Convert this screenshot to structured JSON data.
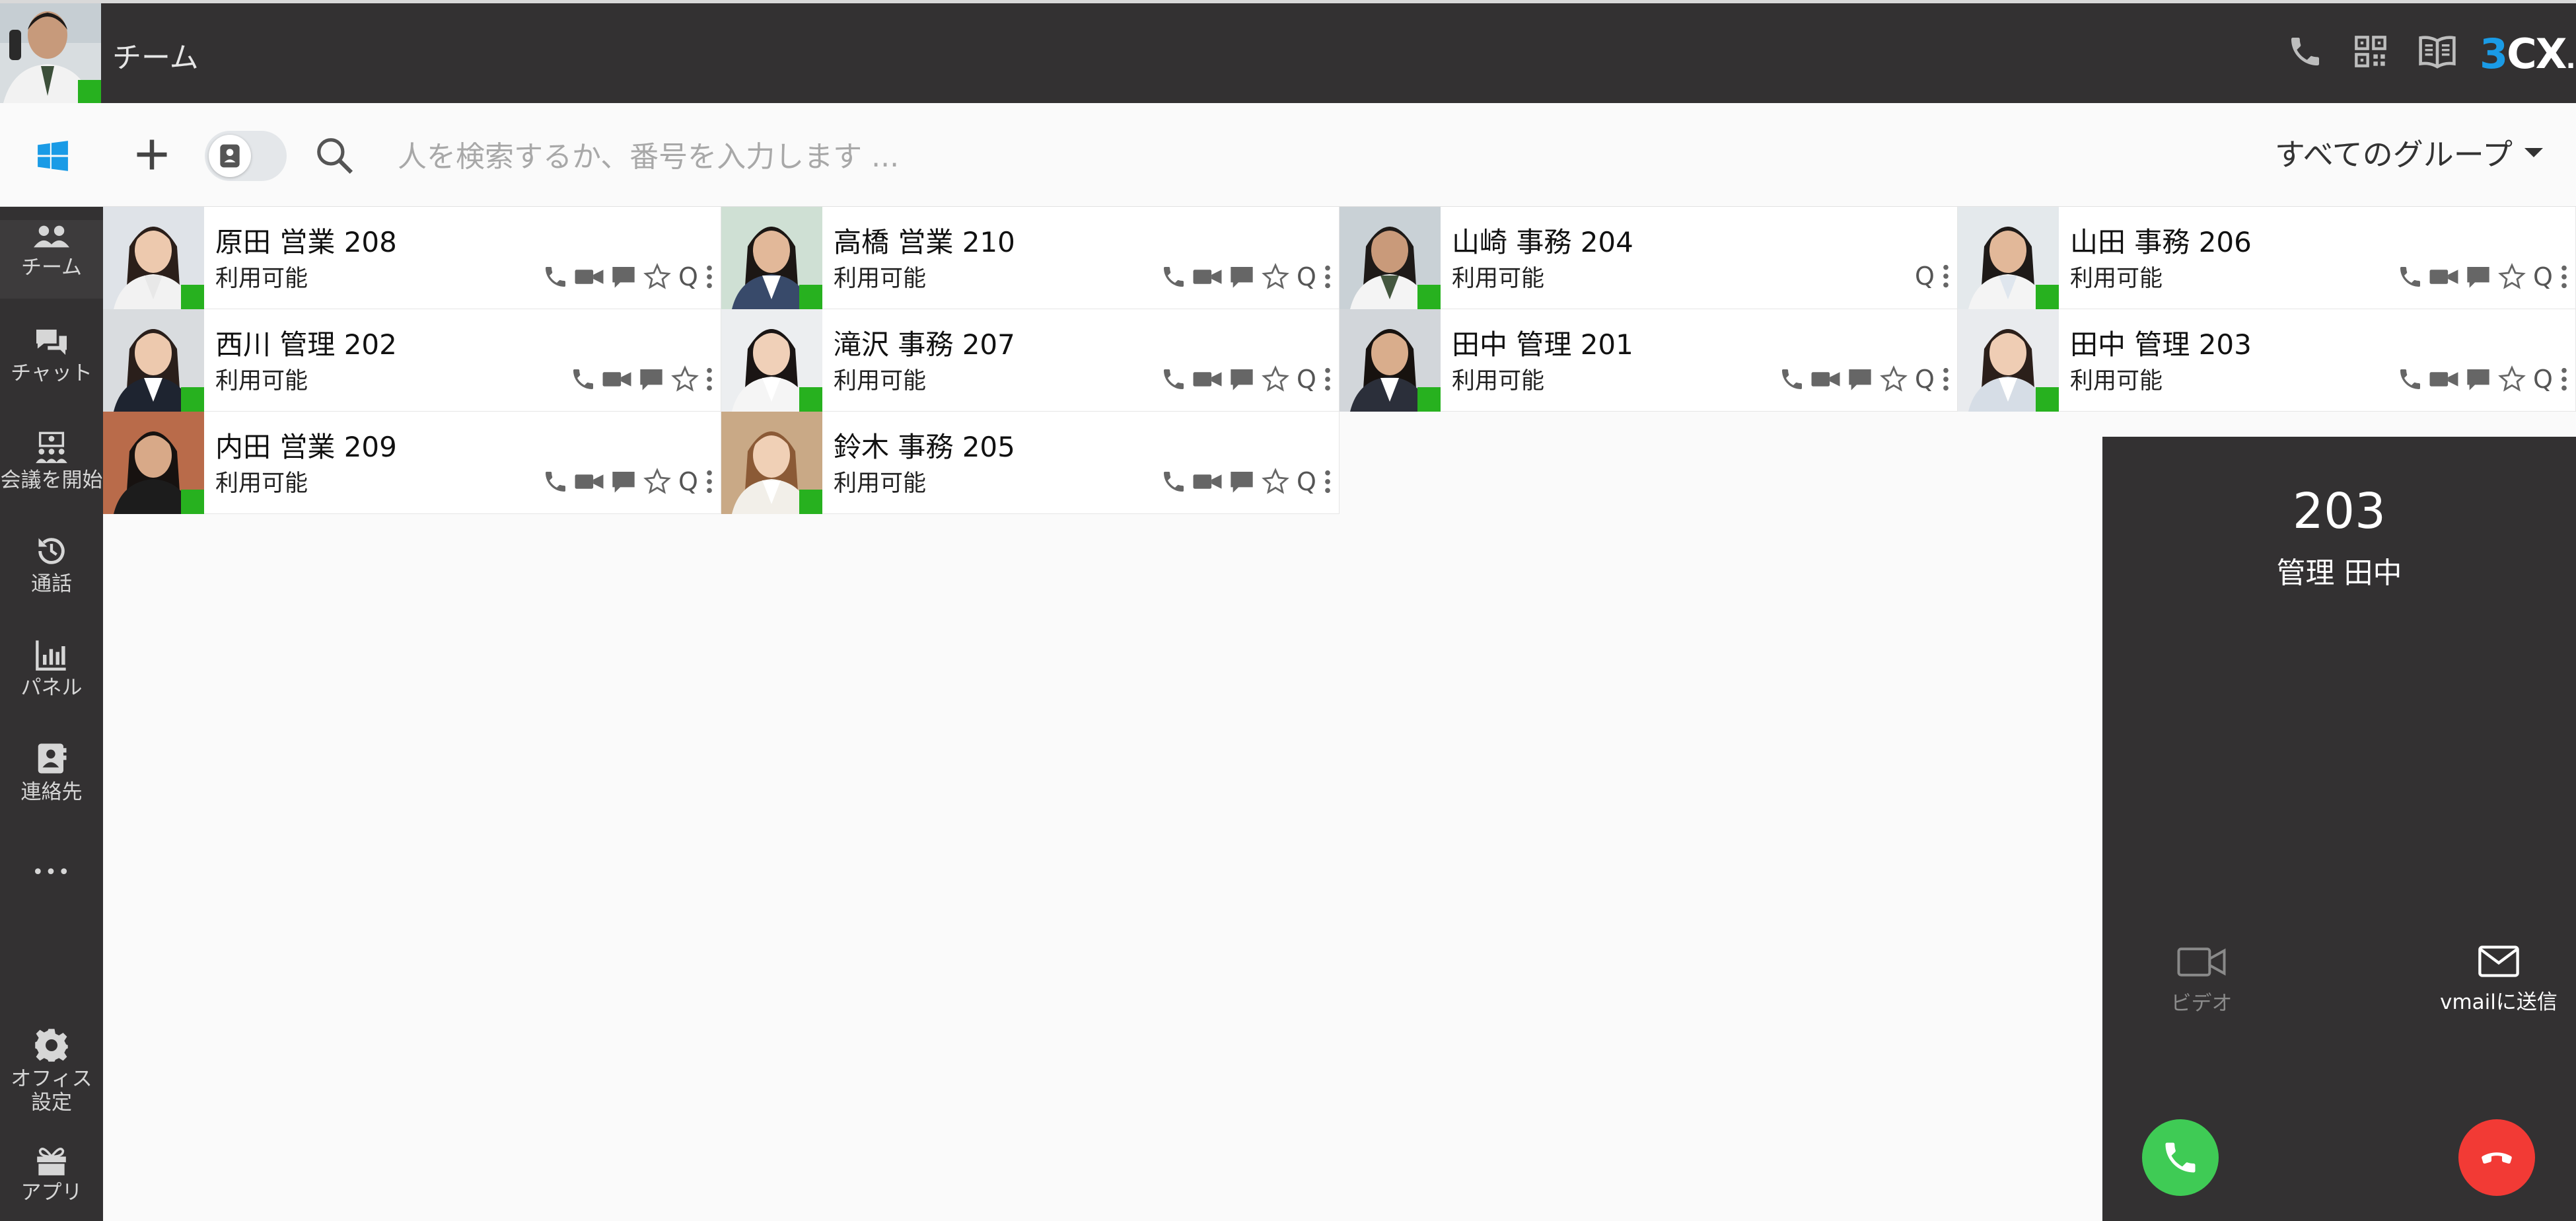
{
  "header": {
    "title": "チーム",
    "logo": {
      "three": "3",
      "cx": "CX",
      "dot": "."
    }
  },
  "toolbar": {
    "search_placeholder": "人を検索するか、番号を入力します ...",
    "group_filter": "すべてのグループ"
  },
  "sidebar": {
    "items": [
      {
        "label": "チーム",
        "icon": "team-icon"
      },
      {
        "label": "チャット",
        "icon": "chat-icon"
      },
      {
        "label": "会議を開始",
        "icon": "meeting-icon"
      },
      {
        "label": "通話",
        "icon": "history-icon"
      },
      {
        "label": "パネル",
        "icon": "panel-icon"
      },
      {
        "label": "連絡先",
        "icon": "contacts-icon"
      },
      {
        "label": "•••",
        "icon": "more-icon"
      }
    ],
    "office_settings": "オフィス設定",
    "apps": "アプリ"
  },
  "contacts": [
    {
      "name": "原田 営業 208",
      "status": "利用可能"
    },
    {
      "name": "高橋 営業 210",
      "status": "利用可能"
    },
    {
      "name": "山崎 事務 204",
      "status": "利用可能"
    },
    {
      "name": "山田 事務 206",
      "status": "利用可能"
    },
    {
      "name": "西川 管理 202",
      "status": "利用可能"
    },
    {
      "name": "滝沢 事務 207",
      "status": "利用可能"
    },
    {
      "name": "田中 管理 201",
      "status": "利用可能"
    },
    {
      "name": "田中 管理 203",
      "status": "利用可能"
    },
    {
      "name": "内田 営業 209",
      "status": "利用可能"
    },
    {
      "name": "鈴木 事務 205",
      "status": "利用可能"
    }
  ],
  "action_q": "Q",
  "call_panel": {
    "number": "203",
    "name": "管理 田中",
    "video_label": "ビデオ",
    "vmail_label": "vmailに送信"
  },
  "colors": {
    "bar": "#333132",
    "status_available": "#27b11f",
    "accent": "#1a9be6",
    "answer": "#3fcb55",
    "decline": "#f23a35"
  }
}
